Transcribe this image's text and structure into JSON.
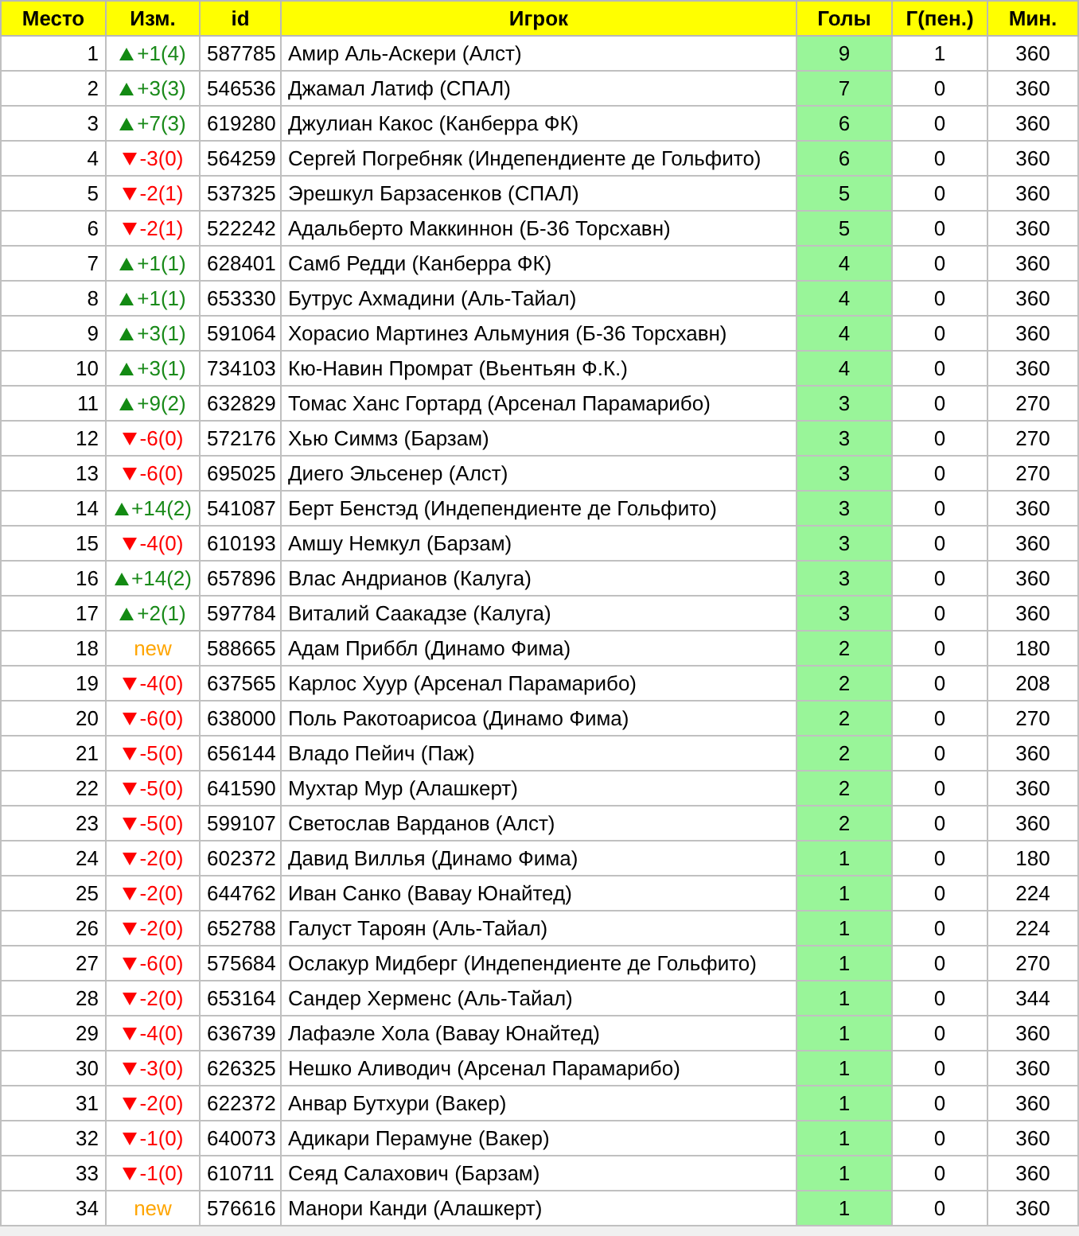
{
  "table": {
    "columns": [
      "Место",
      "Изм.",
      "id",
      "Игрок",
      "Голы",
      "Г(пен.)",
      "Мин."
    ],
    "rows": [
      {
        "place": "1",
        "change": {
          "kind": "up",
          "text": "+1(4)"
        },
        "id": "587785",
        "player": "Амир Аль-Аскери (Алст)",
        "goals": "9",
        "penalty_goals": "1",
        "minutes": "360"
      },
      {
        "place": "2",
        "change": {
          "kind": "up",
          "text": "+3(3)"
        },
        "id": "546536",
        "player": "Джамал Латиф (СПАЛ)",
        "goals": "7",
        "penalty_goals": "0",
        "minutes": "360"
      },
      {
        "place": "3",
        "change": {
          "kind": "up",
          "text": "+7(3)"
        },
        "id": "619280",
        "player": "Джулиан Какос (Канберра ФК)",
        "goals": "6",
        "penalty_goals": "0",
        "minutes": "360"
      },
      {
        "place": "4",
        "change": {
          "kind": "down",
          "text": "-3(0)"
        },
        "id": "564259",
        "player": "Сергей Погребняк (Индепендиенте де Гольфито)",
        "goals": "6",
        "penalty_goals": "0",
        "minutes": "360"
      },
      {
        "place": "5",
        "change": {
          "kind": "down",
          "text": "-2(1)"
        },
        "id": "537325",
        "player": "Эрешкул Барзасенков (СПАЛ)",
        "goals": "5",
        "penalty_goals": "0",
        "minutes": "360"
      },
      {
        "place": "6",
        "change": {
          "kind": "down",
          "text": "-2(1)"
        },
        "id": "522242",
        "player": "Адальберто Маккиннон (Б-36 Торсхавн)",
        "goals": "5",
        "penalty_goals": "0",
        "minutes": "360"
      },
      {
        "place": "7",
        "change": {
          "kind": "up",
          "text": "+1(1)"
        },
        "id": "628401",
        "player": "Самб Редди (Канберра ФК)",
        "goals": "4",
        "penalty_goals": "0",
        "minutes": "360"
      },
      {
        "place": "8",
        "change": {
          "kind": "up",
          "text": "+1(1)"
        },
        "id": "653330",
        "player": "Бутрус Ахмадини (Аль-Тайал)",
        "goals": "4",
        "penalty_goals": "0",
        "minutes": "360"
      },
      {
        "place": "9",
        "change": {
          "kind": "up",
          "text": "+3(1)"
        },
        "id": "591064",
        "player": "Хорасио Мартинез Альмуния (Б-36 Торсхавн)",
        "goals": "4",
        "penalty_goals": "0",
        "minutes": "360"
      },
      {
        "place": "10",
        "change": {
          "kind": "up",
          "text": "+3(1)"
        },
        "id": "734103",
        "player": "Кю-Навин Промрат (Вьентьян Ф.К.)",
        "goals": "4",
        "penalty_goals": "0",
        "minutes": "360"
      },
      {
        "place": "11",
        "change": {
          "kind": "up",
          "text": "+9(2)"
        },
        "id": "632829",
        "player": "Томас Ханс Гортард (Арсенал Парамарибо)",
        "goals": "3",
        "penalty_goals": "0",
        "minutes": "270"
      },
      {
        "place": "12",
        "change": {
          "kind": "down",
          "text": "-6(0)"
        },
        "id": "572176",
        "player": "Хью Симмз (Барзам)",
        "goals": "3",
        "penalty_goals": "0",
        "minutes": "270"
      },
      {
        "place": "13",
        "change": {
          "kind": "down",
          "text": "-6(0)"
        },
        "id": "695025",
        "player": "Диего Эльсенер (Алст)",
        "goals": "3",
        "penalty_goals": "0",
        "minutes": "270"
      },
      {
        "place": "14",
        "change": {
          "kind": "up",
          "text": "+14(2)"
        },
        "id": "541087",
        "player": "Берт Бенстэд (Индепендиенте де Гольфито)",
        "goals": "3",
        "penalty_goals": "0",
        "minutes": "360"
      },
      {
        "place": "15",
        "change": {
          "kind": "down",
          "text": "-4(0)"
        },
        "id": "610193",
        "player": "Амшу Немкул (Барзам)",
        "goals": "3",
        "penalty_goals": "0",
        "minutes": "360"
      },
      {
        "place": "16",
        "change": {
          "kind": "up",
          "text": "+14(2)"
        },
        "id": "657896",
        "player": "Влас Андрианов (Калуга)",
        "goals": "3",
        "penalty_goals": "0",
        "minutes": "360"
      },
      {
        "place": "17",
        "change": {
          "kind": "up",
          "text": "+2(1)"
        },
        "id": "597784",
        "player": "Виталий Саакадзе (Калуга)",
        "goals": "3",
        "penalty_goals": "0",
        "minutes": "360"
      },
      {
        "place": "18",
        "change": {
          "kind": "new",
          "text": "new"
        },
        "id": "588665",
        "player": "Адам Приббл (Динамо Фима)",
        "goals": "2",
        "penalty_goals": "0",
        "minutes": "180"
      },
      {
        "place": "19",
        "change": {
          "kind": "down",
          "text": "-4(0)"
        },
        "id": "637565",
        "player": "Карлос Хуур (Арсенал Парамарибо)",
        "goals": "2",
        "penalty_goals": "0",
        "minutes": "208"
      },
      {
        "place": "20",
        "change": {
          "kind": "down",
          "text": "-6(0)"
        },
        "id": "638000",
        "player": "Поль Ракотоарисоа (Динамо Фима)",
        "goals": "2",
        "penalty_goals": "0",
        "minutes": "270"
      },
      {
        "place": "21",
        "change": {
          "kind": "down",
          "text": "-5(0)"
        },
        "id": "656144",
        "player": "Владо Пейич (Паж)",
        "goals": "2",
        "penalty_goals": "0",
        "minutes": "360"
      },
      {
        "place": "22",
        "change": {
          "kind": "down",
          "text": "-5(0)"
        },
        "id": "641590",
        "player": "Мухтар Мур (Алашкерт)",
        "goals": "2",
        "penalty_goals": "0",
        "minutes": "360"
      },
      {
        "place": "23",
        "change": {
          "kind": "down",
          "text": "-5(0)"
        },
        "id": "599107",
        "player": "Светослав Варданов (Алст)",
        "goals": "2",
        "penalty_goals": "0",
        "minutes": "360"
      },
      {
        "place": "24",
        "change": {
          "kind": "down",
          "text": "-2(0)"
        },
        "id": "602372",
        "player": "Давид Виллья (Динамо Фима)",
        "goals": "1",
        "penalty_goals": "0",
        "minutes": "180"
      },
      {
        "place": "25",
        "change": {
          "kind": "down",
          "text": "-2(0)"
        },
        "id": "644762",
        "player": "Иван Санко (Вавау Юнайтед)",
        "goals": "1",
        "penalty_goals": "0",
        "minutes": "224"
      },
      {
        "place": "26",
        "change": {
          "kind": "down",
          "text": "-2(0)"
        },
        "id": "652788",
        "player": "Галуст Тароян (Аль-Тайал)",
        "goals": "1",
        "penalty_goals": "0",
        "minutes": "224"
      },
      {
        "place": "27",
        "change": {
          "kind": "down",
          "text": "-6(0)"
        },
        "id": "575684",
        "player": "Ослакур Мидберг (Индепендиенте де Гольфито)",
        "goals": "1",
        "penalty_goals": "0",
        "minutes": "270"
      },
      {
        "place": "28",
        "change": {
          "kind": "down",
          "text": "-2(0)"
        },
        "id": "653164",
        "player": "Сандер Херменс (Аль-Тайал)",
        "goals": "1",
        "penalty_goals": "0",
        "minutes": "344"
      },
      {
        "place": "29",
        "change": {
          "kind": "down",
          "text": "-4(0)"
        },
        "id": "636739",
        "player": "Лафаэле Хола (Вавау Юнайтед)",
        "goals": "1",
        "penalty_goals": "0",
        "minutes": "360"
      },
      {
        "place": "30",
        "change": {
          "kind": "down",
          "text": "-3(0)"
        },
        "id": "626325",
        "player": "Нешко Аливодич (Арсенал Парамарибо)",
        "goals": "1",
        "penalty_goals": "0",
        "minutes": "360"
      },
      {
        "place": "31",
        "change": {
          "kind": "down",
          "text": "-2(0)"
        },
        "id": "622372",
        "player": "Анвар Бутхури (Вакер)",
        "goals": "1",
        "penalty_goals": "0",
        "minutes": "360"
      },
      {
        "place": "32",
        "change": {
          "kind": "down",
          "text": "-1(0)"
        },
        "id": "640073",
        "player": "Адикари Перамуне (Вакер)",
        "goals": "1",
        "penalty_goals": "0",
        "minutes": "360"
      },
      {
        "place": "33",
        "change": {
          "kind": "down",
          "text": "-1(0)"
        },
        "id": "610711",
        "player": "Сеяд Салахович (Барзам)",
        "goals": "1",
        "penalty_goals": "0",
        "minutes": "360"
      },
      {
        "place": "34",
        "change": {
          "kind": "new",
          "text": "new"
        },
        "id": "576616",
        "player": "Манори Канди (Алашкерт)",
        "goals": "1",
        "penalty_goals": "0",
        "minutes": "360"
      }
    ]
  }
}
